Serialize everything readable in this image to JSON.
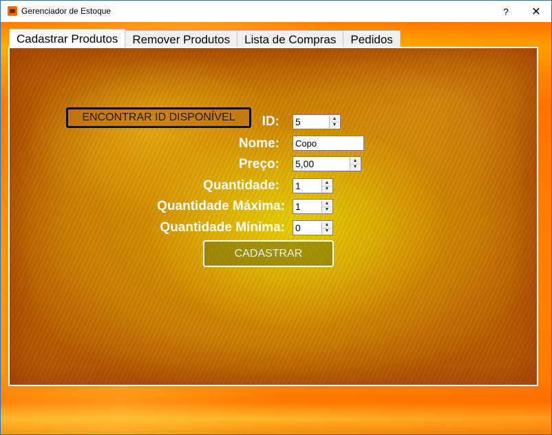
{
  "window": {
    "title": "Gerenciador de Estoque",
    "help_label": "?",
    "close_label": "✕"
  },
  "tabs": [
    {
      "label": "Cadastrar Produtos",
      "active": true
    },
    {
      "label": "Remover Produtos",
      "active": false
    },
    {
      "label": "Lista de Compras",
      "active": false
    },
    {
      "label": "Pedidos",
      "active": false
    }
  ],
  "form": {
    "find_id_button": "ENCONTRAR ID DISPONÍVEL",
    "id": {
      "label": "ID:",
      "value": "5"
    },
    "nome": {
      "label": "Nome:",
      "value": "Copo"
    },
    "preco": {
      "label": "Preço:",
      "value": "5,00"
    },
    "quantidade": {
      "label": "Quantidade:",
      "value": "1"
    },
    "quantidade_maxima": {
      "label": "Quantidade Máxima:",
      "value": "1"
    },
    "quantidade_minima": {
      "label": "Quantidade Mínima:",
      "value": "0"
    },
    "submit_button": "CADASTRAR"
  },
  "icons": {
    "app": "app-icon",
    "spin_up": "▲",
    "spin_down": "▼"
  },
  "colors": {
    "accent": "#ff8a00",
    "panel": "#c98a00"
  }
}
